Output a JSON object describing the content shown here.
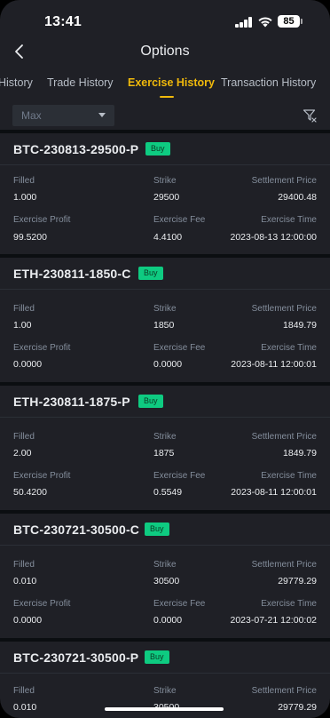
{
  "status": {
    "time": "13:41",
    "battery": "85"
  },
  "nav": {
    "title": "Options"
  },
  "tabs": [
    {
      "label": "History"
    },
    {
      "label": "Trade History"
    },
    {
      "label": "Exercise History"
    },
    {
      "label": "Transaction History"
    }
  ],
  "filter": {
    "period": "Max"
  },
  "field_labels": {
    "filled": "Filled",
    "strike": "Strike",
    "settlement": "Settlement Price",
    "profit": "Exercise Profit",
    "fee": "Exercise Fee",
    "time": "Exercise Time"
  },
  "records": [
    {
      "symbol": "BTC-230813-29500-P",
      "side": "Buy",
      "filled": "1.000",
      "strike": "29500",
      "settlement": "29400.48",
      "profit": "99.5200",
      "fee": "4.4100",
      "time": "2023-08-13 12:00:00"
    },
    {
      "symbol": "ETH-230811-1850-C",
      "side": "Buy",
      "filled": "1.00",
      "strike": "1850",
      "settlement": "1849.79",
      "profit": "0.0000",
      "fee": "0.0000",
      "time": "2023-08-11 12:00:01"
    },
    {
      "symbol": "ETH-230811-1875-P",
      "side": "Buy",
      "filled": "2.00",
      "strike": "1875",
      "settlement": "1849.79",
      "profit": "50.4200",
      "fee": "0.5549",
      "time": "2023-08-11 12:00:01"
    },
    {
      "symbol": "BTC-230721-30500-C",
      "side": "Buy",
      "filled": "0.010",
      "strike": "30500",
      "settlement": "29779.29",
      "profit": "0.0000",
      "fee": "0.0000",
      "time": "2023-07-21 12:00:02"
    },
    {
      "symbol": "BTC-230721-30500-P",
      "side": "Buy",
      "filled": "0.010",
      "strike": "30500",
      "settlement": "29779.29",
      "profit": "",
      "fee": "",
      "time": ""
    }
  ],
  "colors": {
    "accent": "#f0b90b",
    "buy": "#0ecb81",
    "background": "#1f2026"
  }
}
